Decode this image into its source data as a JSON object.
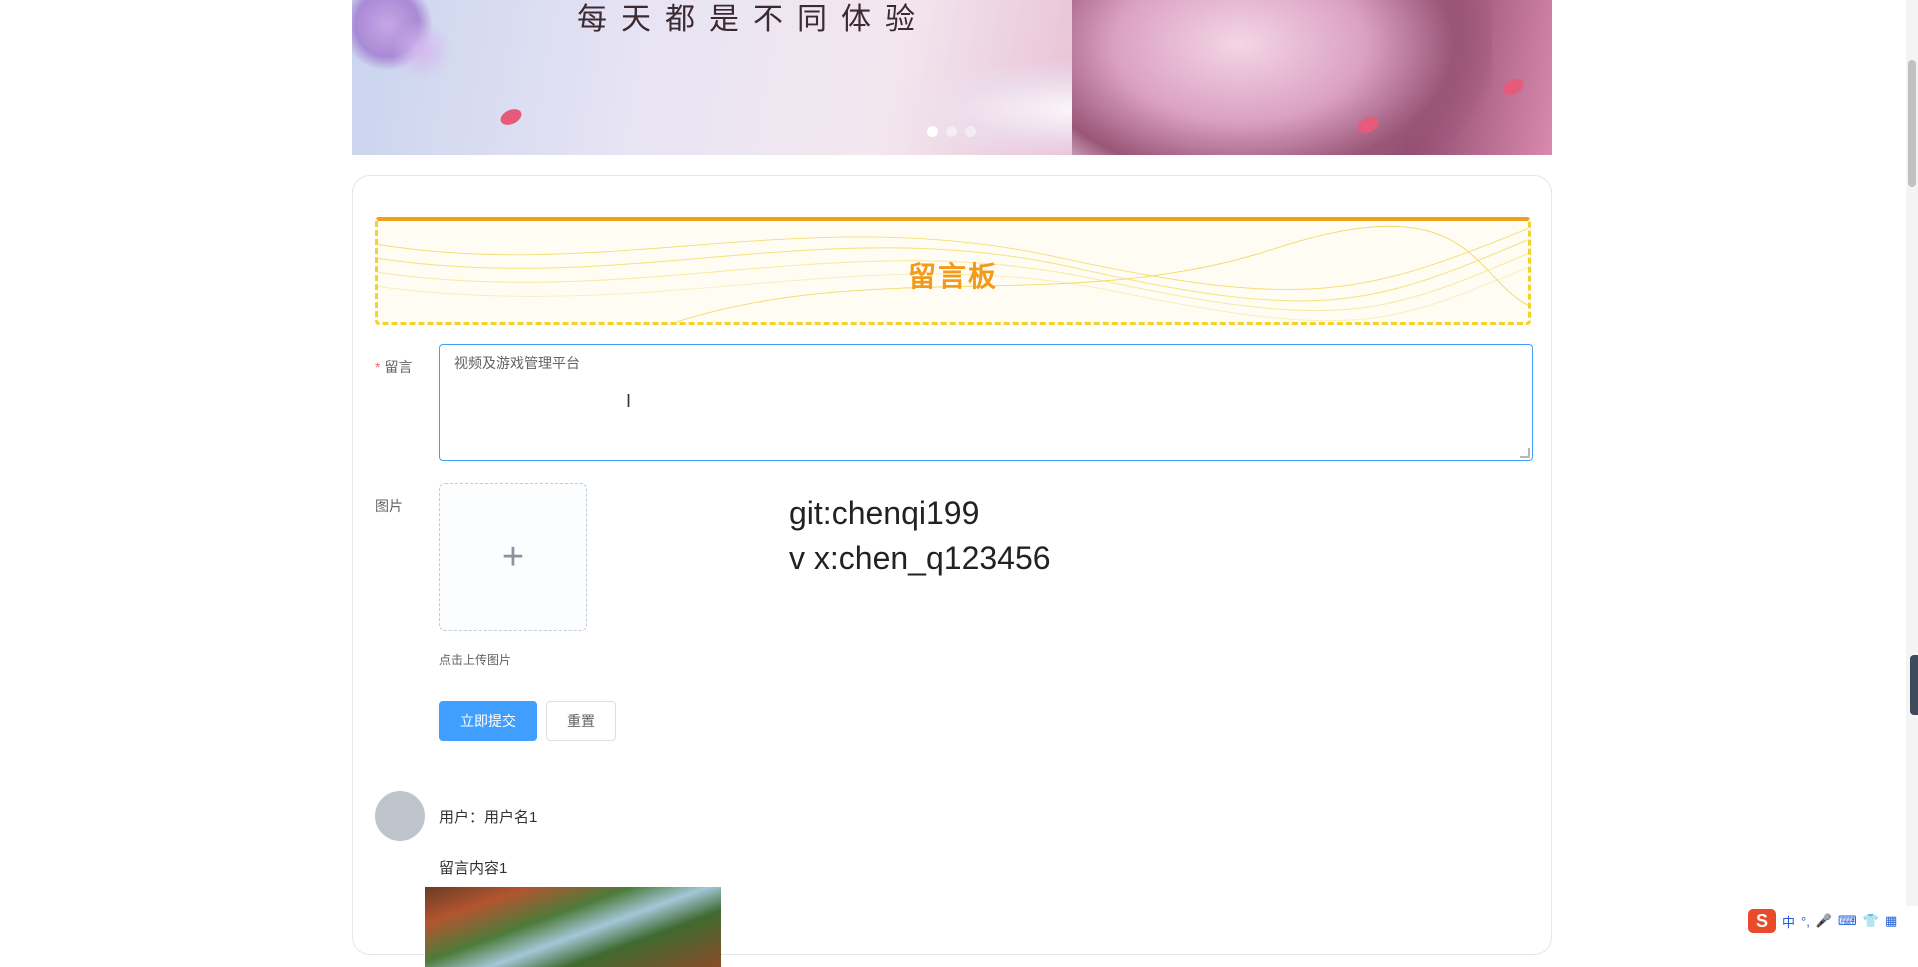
{
  "banner": {
    "slogan": "每天都是不同体验",
    "slides_total": 3,
    "slide_active": 1
  },
  "board": {
    "title": "留言板"
  },
  "form": {
    "message_label": "留言",
    "message_required_mark": "*",
    "message_value": "视频及游戏管理平台",
    "image_label": "图片",
    "upload_tip": "点击上传图片",
    "submit_label": "立即提交",
    "reset_label": "重置"
  },
  "watermark": {
    "line1": "git:chenqi199",
    "line2": "v x:chen_q123456"
  },
  "comments": [
    {
      "user_text": "用户：用户名1",
      "content": "留言内容1"
    }
  ],
  "ime": {
    "logo": "S",
    "mode": "中",
    "punct": "°,"
  },
  "colors": {
    "primary": "#409eff",
    "title_orange": "#f39a1b",
    "title_border_yellow": "#f3d22c",
    "required_red": "#f56c6c"
  }
}
